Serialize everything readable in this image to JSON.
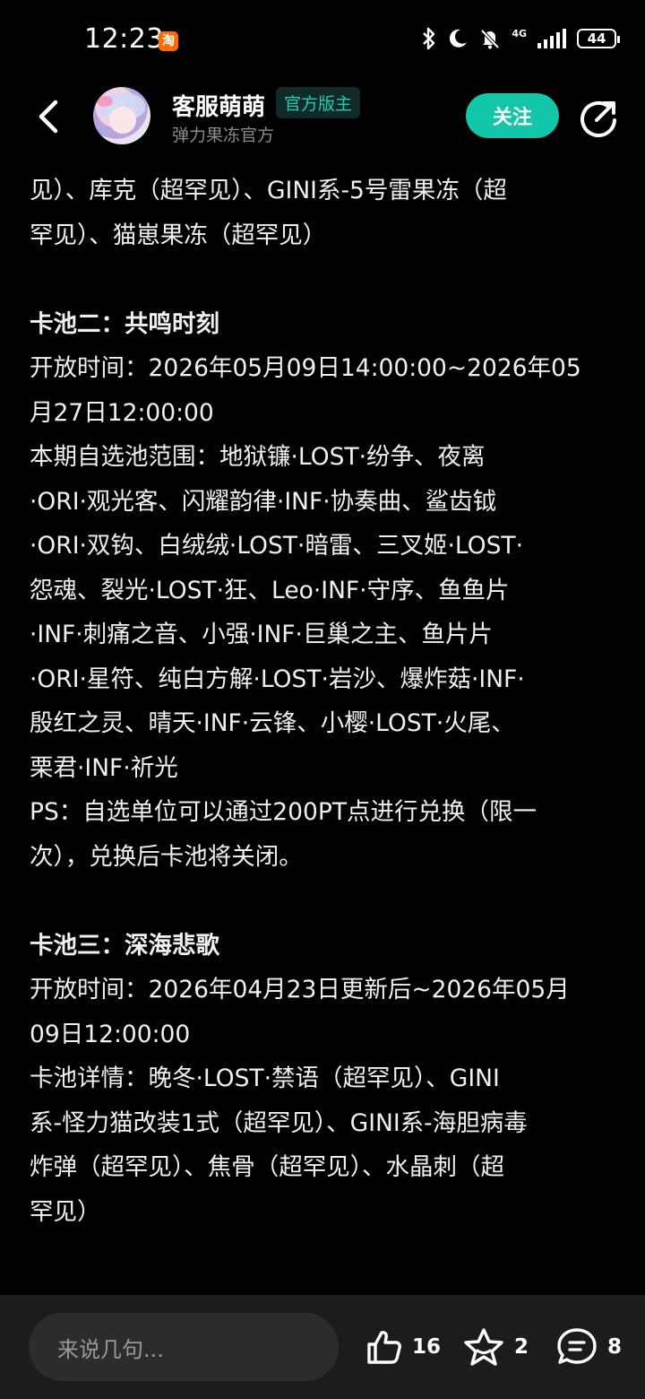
{
  "status_bar": {
    "time": "12:23",
    "taobao_icon": "淘",
    "network": "4G",
    "battery": "44"
  },
  "header": {
    "name": "客服萌萌",
    "badge": "官方版主",
    "subtitle": "弹力果冻官方",
    "follow_label": "关注"
  },
  "content": {
    "lines": [
      "见）、库克（超罕见）、GINI系-5号雷果冻（超",
      "罕见）、猫崽果冻（超罕见）",
      "",
      "卡池二：共鸣时刻",
      "开放时间：2026年05月09日14:00:00~2026年05",
      "月27日12:00:00",
      "本期自选池范围：地狱镰·LOST·纷争、夜离",
      "·ORI·观光客、闪耀韵律·INF·协奏曲、鲨齿钺",
      "·ORI·双钩、白绒绒·LOST·暗雷、三叉姬·LOST·",
      "怨魂、裂光·LOST·狂、Leo·INF·守序、鱼鱼片",
      "·INF·刺痛之音、小强·INF·巨巢之主、鱼片片",
      "·ORI·星符、纯白方解·LOST·岩沙、爆炸菇·INF·",
      "殷红之灵、晴天·INF·云锋、小樱·LOST·火尾、",
      "栗君·INF·祈光",
      " PS：自选单位可以通过200PT点进行兑换（限一",
      "次），兑换后卡池将关闭。",
      "",
      "卡池三：深海悲歌",
      "开放时间：2026年04月23日更新后~2026年05月",
      "09日12:00:00",
      "卡池详情：晚冬·LOST·禁语（超罕见）、GINI",
      "系-怪力猫改装1式（超罕见）、GINI系-海胆病毒",
      "炸弹（超罕见）、焦骨（超罕见）、水晶刺（超",
      "罕见）"
    ],
    "bold_lines": [
      3,
      17
    ]
  },
  "bottom_bar": {
    "comment_placeholder": "来说几句...",
    "like_count": "16",
    "favorite_count": "2",
    "comment_count": "8"
  },
  "colors": {
    "accent": "#12c6a9",
    "badge_text": "#1ecfb3",
    "background": "#000000",
    "bottom_bar": "#1c1c1e"
  },
  "icons": [
    "back-arrow-icon",
    "share-icon",
    "like-icon",
    "favorite-star-icon",
    "comment-icon",
    "bluetooth-icon",
    "moon-icon",
    "mute-icon",
    "signal-icon"
  ]
}
